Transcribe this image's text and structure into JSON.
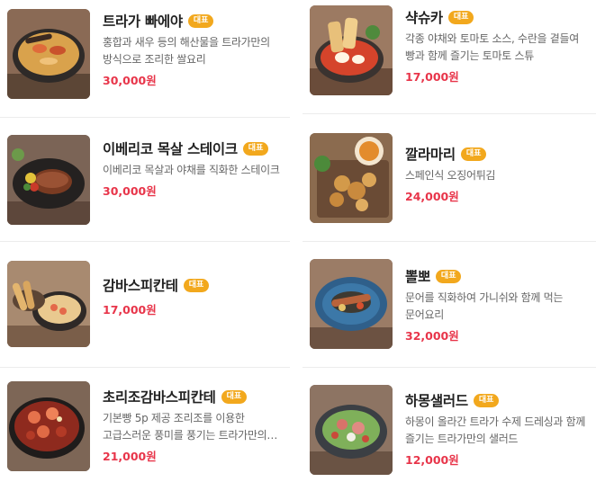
{
  "badge_label": "대표",
  "accent_color": "#e8354a",
  "badge_color": "#f2a81d",
  "items": [
    {
      "name": "트라가 빠에야",
      "desc": "홍합과 새우 등의 해산물을 트라가만의 방식으로 조리한 쌀요리",
      "price": "30,000원",
      "image": "paella-pan-image"
    },
    {
      "name": "샥슈카",
      "desc": "각종 야채와 토마토 소스, 수란을 곁들여 빵과 함께 즐기는 토마토 스튜",
      "price": "17,000원",
      "image": "shakshuka-image"
    },
    {
      "name": "이베리코 목살 스테이크",
      "desc": "이베리코 목살과 야채를 직화한 스테이크",
      "price": "30,000원",
      "image": "steak-image"
    },
    {
      "name": "깔라마리",
      "desc": "스페인식 오징어튀김",
      "price": "24,000원",
      "image": "calamari-image"
    },
    {
      "name": "감바스피칸테",
      "desc": "",
      "price": "17,000원",
      "image": "gambas-image"
    },
    {
      "name": "뽈뽀",
      "desc": "문어를 직화하여 가니쉬와 함께 먹는 문어요리",
      "price": "32,000원",
      "image": "pulpo-image"
    },
    {
      "name": "초리조감바스피칸테",
      "desc": "기본빵 5p 제공 조리조를 이용한 고급스러운 풍미를 풍기는 트라가만의 조리법",
      "price": "21,000원",
      "image": "chorizo-gambas-image"
    },
    {
      "name": "하몽샐러드",
      "desc": "하몽이 올라간 트라가 수제 드레싱과 함께 즐기는 트라가만의 샐러드",
      "price": "12,000원",
      "image": "jamon-salad-image"
    }
  ]
}
